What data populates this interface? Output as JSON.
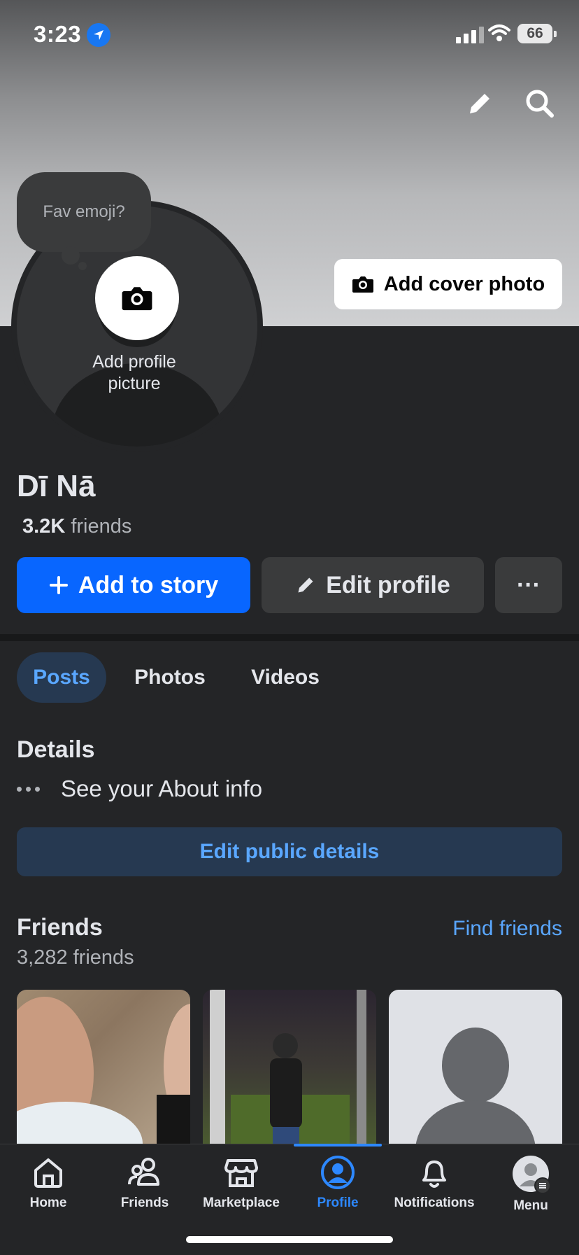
{
  "status": {
    "time": "3:23",
    "battery": "66"
  },
  "cover": {
    "add_cover_label": "Add cover photo"
  },
  "avatar": {
    "prompt_bubble": "Fav emoji?",
    "add_picture_label": "Add profile picture"
  },
  "profile": {
    "name": "Dī Nā",
    "friends_count": "3.2K",
    "friends_word": "friends"
  },
  "actions": {
    "add_story": "Add to story",
    "edit_profile": "Edit profile",
    "more": "···"
  },
  "tabs": [
    {
      "label": "Posts",
      "active": true
    },
    {
      "label": "Photos",
      "active": false
    },
    {
      "label": "Videos",
      "active": false
    }
  ],
  "details": {
    "title": "Details",
    "about": "See your About info",
    "edit_public": "Edit public details"
  },
  "friends": {
    "title": "Friends",
    "find": "Find friends",
    "total": "3,282 friends"
  },
  "nav": [
    {
      "label": "Home",
      "icon": "home-icon"
    },
    {
      "label": "Friends",
      "icon": "friends-icon"
    },
    {
      "label": "Marketplace",
      "icon": "marketplace-icon"
    },
    {
      "label": "Profile",
      "icon": "profile-icon",
      "active": true
    },
    {
      "label": "Notifications",
      "icon": "bell-icon"
    },
    {
      "label": "Menu",
      "icon": "menu-avatar-icon"
    }
  ],
  "colors": {
    "accent": "#0866ff",
    "link": "#5aa7ff",
    "background": "#242527"
  }
}
